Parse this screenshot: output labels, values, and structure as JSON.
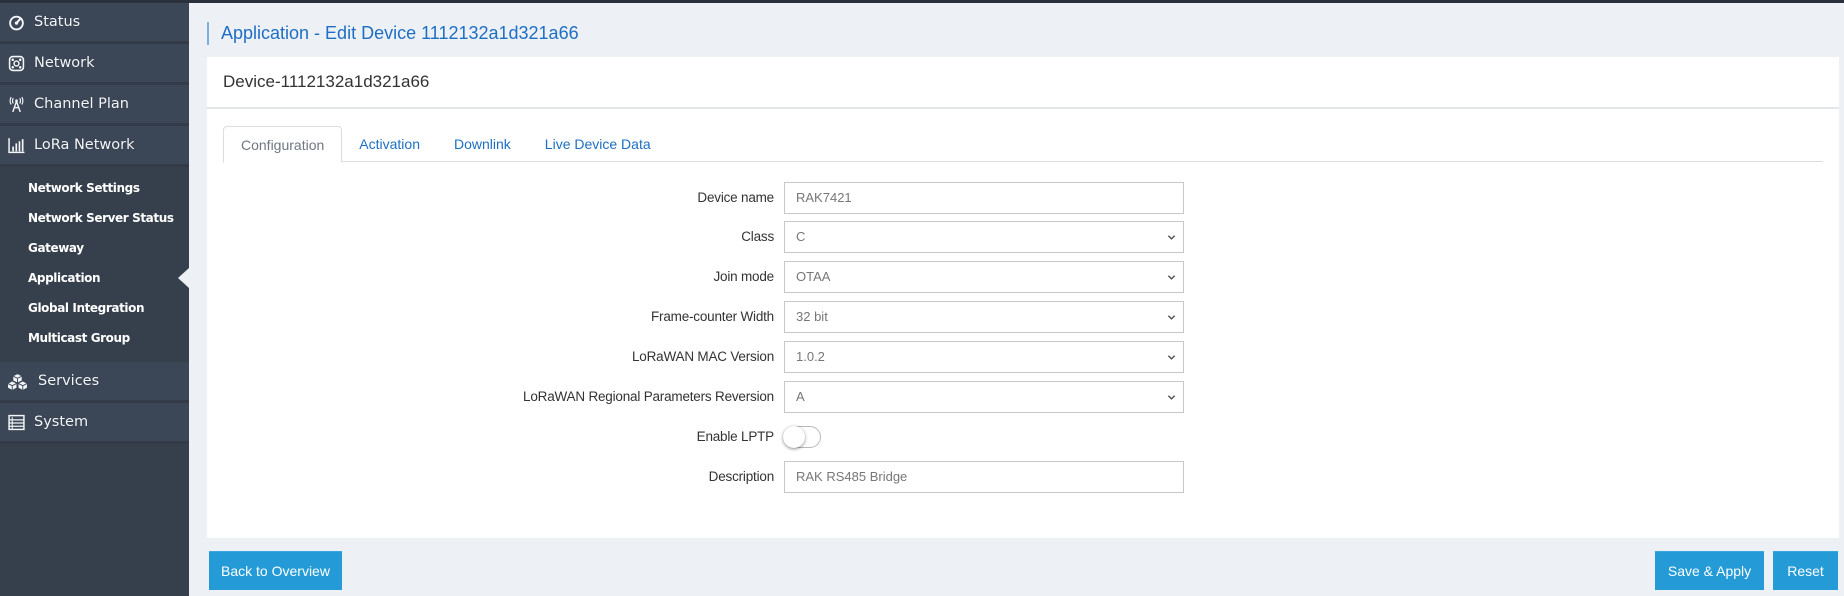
{
  "sidebar": {
    "items": [
      {
        "label": "Status",
        "icon": "gauge-icon"
      },
      {
        "label": "Network",
        "icon": "network-icon"
      },
      {
        "label": "Channel Plan",
        "icon": "antenna-icon"
      },
      {
        "label": "LoRa Network",
        "icon": "signal-bars-icon"
      },
      {
        "label": "Services",
        "icon": "cubes-icon"
      },
      {
        "label": "System",
        "icon": "server-list-icon"
      }
    ],
    "submenu": [
      {
        "label": "Network Settings"
      },
      {
        "label": "Network Server Status"
      },
      {
        "label": "Gateway"
      },
      {
        "label": "Application",
        "active": true
      },
      {
        "label": "Global Integration"
      },
      {
        "label": "Multicast Group"
      }
    ]
  },
  "page": {
    "title": "Application - Edit Device 1112132a1d321a66"
  },
  "card": {
    "header": "Device-1112132a1d321a66",
    "tabs": [
      {
        "label": "Configuration",
        "active": true
      },
      {
        "label": "Activation"
      },
      {
        "label": "Downlink"
      },
      {
        "label": "Live Device Data"
      }
    ]
  },
  "form": {
    "device_name": {
      "label": "Device name",
      "value": "RAK7421"
    },
    "class": {
      "label": "Class",
      "value": "C"
    },
    "join_mode": {
      "label": "Join mode",
      "value": "OTAA"
    },
    "frame_counter_width": {
      "label": "Frame-counter Width",
      "value": "32 bit"
    },
    "mac_version": {
      "label": "LoRaWAN MAC Version",
      "value": "1.0.2"
    },
    "regional_params": {
      "label": "LoRaWAN Regional Parameters Reversion",
      "value": "A"
    },
    "enable_lptp": {
      "label": "Enable LPTP",
      "value": false
    },
    "description": {
      "label": "Description",
      "value": "RAK RS485 Bridge"
    }
  },
  "buttons": {
    "back": "Back to Overview",
    "save": "Save & Apply",
    "reset": "Reset"
  },
  "colors": {
    "accent": "#249bd6",
    "link": "#1d6fc4",
    "sidebar_bg": "#36404d"
  }
}
